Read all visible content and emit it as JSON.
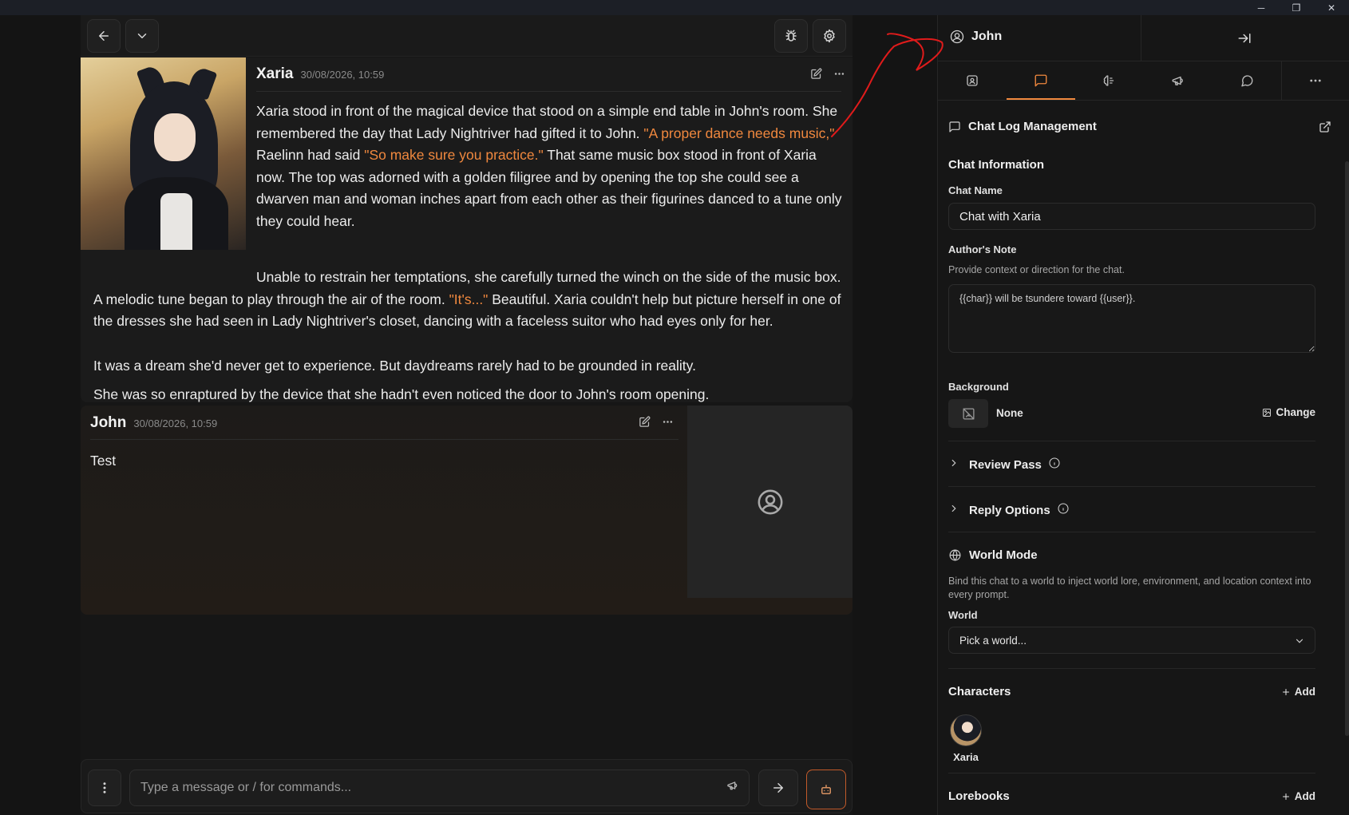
{
  "window": {
    "controls": [
      "─",
      "❐",
      "✕"
    ]
  },
  "chat": {
    "messages": [
      {
        "author": "Xaria",
        "timestamp": "30/08/2026, 10:59",
        "p1": {
          "t1": "Xaria stood in front of the magical device that stood on a simple end table in John's room. She remembered the day that Lady Nightriver had gifted it to John. ",
          "q1": "\"A proper dance needs music,\"",
          "t2": " Raelinn had said ",
          "q2": "\"So make sure you practice.\"",
          "t3": " That same music box stood in front of Xaria now. The top was adorned with a golden filigree and by opening the top she could see a dwarven man and woman inches apart from each other as their figurines danced to a tune only they could hear."
        },
        "p2": {
          "t1": "Unable to restrain her temptations, she carefully turned the winch on the side of the music box. A melodic tune began to play through the air of the room. ",
          "q1": "\"It's...\"",
          "t2": " Beautiful. Xaria couldn't help but picture herself in one of the dresses she had seen in Lady Nightriver's closet, dancing with a faceless suitor who had eyes only for her."
        },
        "p3": "It was a dream she'd never get to experience. But daydreams rarely had to be grounded in reality.",
        "p4": "She was so enraptured by the device that she hadn't even noticed the door to John's room opening."
      },
      {
        "author": "John",
        "timestamp": "30/08/2026, 10:59",
        "text": "Test"
      }
    ],
    "composer": {
      "placeholder": "Type a message or / for commands..."
    }
  },
  "sidebar": {
    "user_name": "John",
    "header_title": "Chat Log Management",
    "chat_info": {
      "section_title": "Chat Information",
      "chat_name_label": "Chat Name",
      "chat_name_value": "Chat with Xaria",
      "authors_note_label": "Author's Note",
      "authors_note_help": "Provide context or direction for the chat.",
      "authors_note_value": "{{char}} will be tsundere toward {{user}}.",
      "background_label": "Background",
      "background_value": "None",
      "background_change": "Change"
    },
    "review_pass": "Review Pass",
    "reply_options": "Reply Options",
    "world_mode": {
      "title": "World Mode",
      "help": "Bind this chat to a world to inject world lore, environment, and location context into every prompt.",
      "world_label": "World",
      "world_placeholder": "Pick a world..."
    },
    "characters": {
      "title": "Characters",
      "add": "Add",
      "items": [
        {
          "name": "Xaria"
        }
      ]
    },
    "lorebooks": {
      "title": "Lorebooks",
      "add": "Add"
    }
  },
  "colors": {
    "accent": "#f0883e",
    "background": "#141414",
    "annotation": "#e01b1b"
  }
}
